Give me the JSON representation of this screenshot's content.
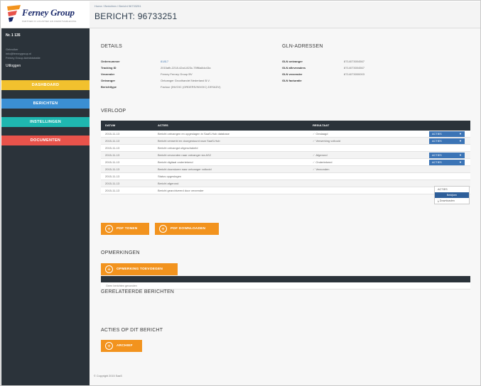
{
  "sidebar": {
    "logo_text": "Ferney Group",
    "logo_tagline": "PARTNER IN LOGISTIEK EN DIENSTVERLENING",
    "user_id": "Nr. 1 135",
    "user_lines": [
      "Gebruiker",
      "info@ferneygroup.nl",
      "Ferney Group Administratie"
    ],
    "logout": "Uitloggen",
    "nav": [
      {
        "label": "DASHBOARD",
        "color": "#f2c12e"
      },
      {
        "label": "BERICHTEN",
        "color": "#3b8fd3"
      },
      {
        "label": "INSTELLINGEN",
        "color": "#1fb7b0"
      },
      {
        "label": "DOCUMENTEN",
        "color": "#e8534b"
      }
    ]
  },
  "header": {
    "breadcrumb": "Home / Berichten / Bericht 96733251",
    "title": "BERICHT: 96733251"
  },
  "details": {
    "title": "DETAILS",
    "rows": [
      {
        "label": "Ordernummer",
        "value": "81817"
      },
      {
        "label": "Tracking ID",
        "value": "2015afb-2218-42a4-823c-75ff6a8dc43a"
      },
      {
        "label": "Verzender",
        "value": "Ferney Ferney Group BV"
      },
      {
        "label": "Ontvanger",
        "value": "Ontvanger Groothandel Nederland B.V."
      },
      {
        "label": "Berichttype",
        "value": "Factuur (INVOIC (ORDERS/INVOIC) DESADV)"
      }
    ]
  },
  "gln": {
    "title": "GLN-ADRESSEN",
    "rows": [
      {
        "label": "GLN ontvanger",
        "value": "8714073004567"
      },
      {
        "label": "GLN afleveradres",
        "value": "8714073004567"
      },
      {
        "label": "GLN verzender",
        "value": "8714073000003"
      },
      {
        "label": "GLN facturatie",
        "value": ""
      }
    ]
  },
  "verloop": {
    "title": "VERLOOP",
    "headers": [
      "DATUM",
      "ACTIES",
      "RESULTAAT"
    ],
    "rows": [
      {
        "date": "2015-11-13",
        "action": "Bericht ontvangen en opgeslagen in SaaS-Hub database",
        "result": "Geslaagd",
        "button": "ACTIES"
      },
      {
        "date": "2015-11-13",
        "action": "Bericht verwerkt en doorgestuurd naar SaaS-Hub",
        "result": "Verwerking voltooid",
        "button": "ACTIES"
      },
      {
        "date": "2015-11-13",
        "action": "Bericht ontvangst uitgeschakeld",
        "result": "",
        "button": ""
      },
      {
        "date": "2015-11-13",
        "action": "Bericht verzonden naar ontvanger via AS2",
        "result": "Afgerond",
        "button": "ACTIES"
      },
      {
        "date": "2015-11-13",
        "action": "Bericht digitaal ondertekend",
        "result": "Ondertekend",
        "button": "ACTIES"
      },
      {
        "date": "2015-11-13",
        "action": "Bericht doorsturen naar ontvanger voltooid",
        "result": "Verzonden",
        "button": ""
      },
      {
        "date": "2015-11-13",
        "action": "Status opgeslagen",
        "result": "",
        "button": ""
      },
      {
        "date": "2015-11-13",
        "action": "Bericht afgerond",
        "result": "",
        "button": ""
      },
      {
        "date": "2015-11-13",
        "action": "Bericht gearchiveerd door verzender",
        "result": "",
        "button": ""
      }
    ],
    "dropdown": [
      "ACTIES",
      "Bekijken",
      "Downloaden"
    ]
  },
  "buttons": {
    "pdf_tonen": "PDF TONEN",
    "pdf_downloaden": "PDF DOWNLOADEN",
    "opmerking_toevoegen": "OPMERKING TOEVOEGEN",
    "archief": "ARCHIEF"
  },
  "opmerkingen": {
    "title": "OPMERKINGEN"
  },
  "gerelateerd": {
    "title": "GERELATEERDE BERICHTEN",
    "empty_text": "Geen berichten gevonden"
  },
  "acties": {
    "title": "ACTIES OP DIT BERICHT"
  },
  "footer": {
    "text": "© Copyright 2015 SaaS"
  }
}
